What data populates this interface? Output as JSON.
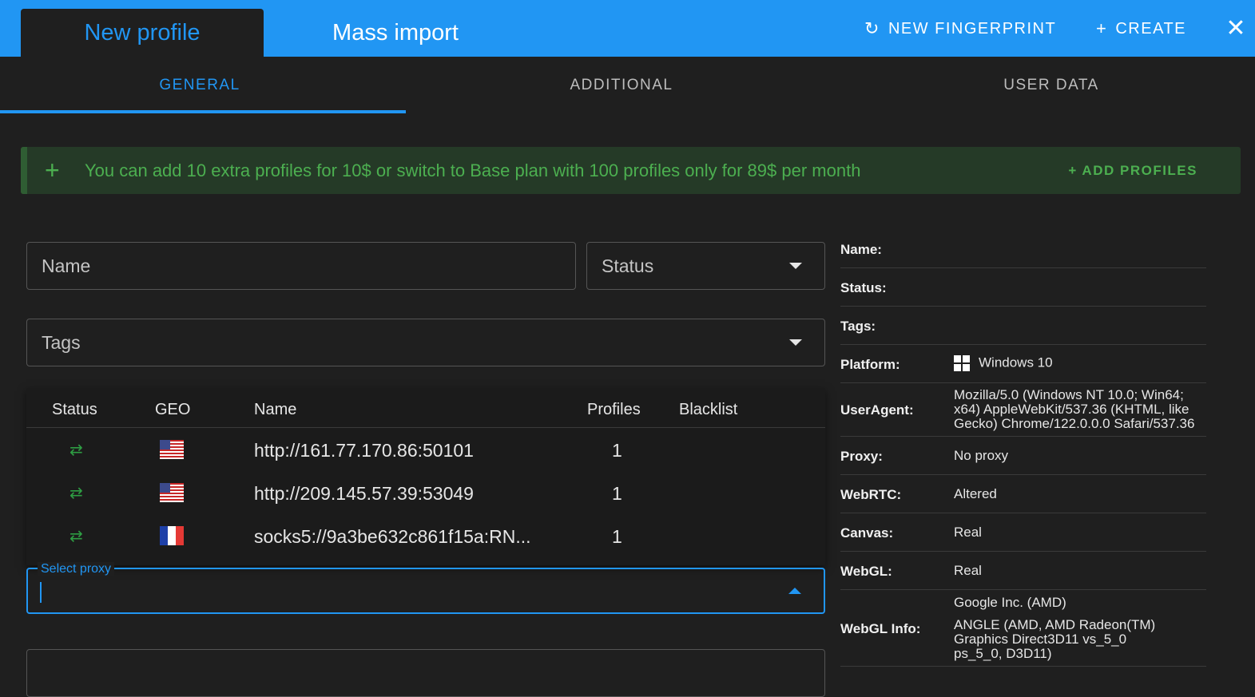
{
  "header": {
    "tabs": [
      {
        "label": "New profile",
        "active": true
      },
      {
        "label": "Mass import",
        "active": false
      }
    ],
    "new_fingerprint_label": "NEW FINGERPRINT",
    "create_label": "CREATE",
    "close_label": "✕",
    "accent_color": "#2196f3"
  },
  "subtabs": [
    {
      "label": "GENERAL",
      "active": true
    },
    {
      "label": "ADDITIONAL",
      "active": false
    },
    {
      "label": "USER DATA",
      "active": false
    }
  ],
  "banner": {
    "message": "You can add 10 extra profiles for 10$ or switch to Base plan with 100 profiles only for 89$ per month",
    "action_label": "+ ADD PROFILES"
  },
  "form": {
    "name_placeholder": "Name",
    "status_placeholder": "Status",
    "tags_placeholder": "Tags",
    "proxy_label": "Select proxy"
  },
  "proxy_table": {
    "columns": [
      "Status",
      "GEO",
      "Name",
      "Profiles",
      "Blacklist"
    ],
    "rows": [
      {
        "status_icon": "arrows-exchange-icon",
        "geo": "US",
        "name": "http://161.77.170.86:50101",
        "profiles": "1",
        "blacklist": ""
      },
      {
        "status_icon": "arrows-exchange-icon",
        "geo": "US",
        "name": "http://209.145.57.39:53049",
        "profiles": "1",
        "blacklist": ""
      },
      {
        "status_icon": "arrows-exchange-icon",
        "geo": "FR",
        "name": "socks5://9a3be632c861f15a:RN...",
        "profiles": "1",
        "blacklist": ""
      }
    ]
  },
  "summary": {
    "name_label": "Name:",
    "name_value": "",
    "status_label": "Status:",
    "status_value": "",
    "tags_label": "Tags:",
    "tags_value": "",
    "platform_label": "Platform:",
    "platform_value": "Windows 10",
    "useragent_label": "UserAgent:",
    "useragent_value": "Mozilla/5.0 (Windows NT 10.0; Win64; x64) AppleWebKit/537.36 (KHTML, like Gecko) Chrome/122.0.0.0 Safari/537.36",
    "proxy_label": "Proxy:",
    "proxy_value": "No proxy",
    "webrtc_label": "WebRTC:",
    "webrtc_value": "Altered",
    "canvas_label": "Canvas:",
    "canvas_value": "Real",
    "webgl_label": "WebGL:",
    "webgl_value": "Real",
    "webglinfo_label": "WebGL Info:",
    "webglinfo_vendor": "Google Inc. (AMD)",
    "webglinfo_renderer": "ANGLE (AMD, AMD Radeon(TM) Graphics Direct3D11 vs_5_0 ps_5_0, D3D11)"
  }
}
